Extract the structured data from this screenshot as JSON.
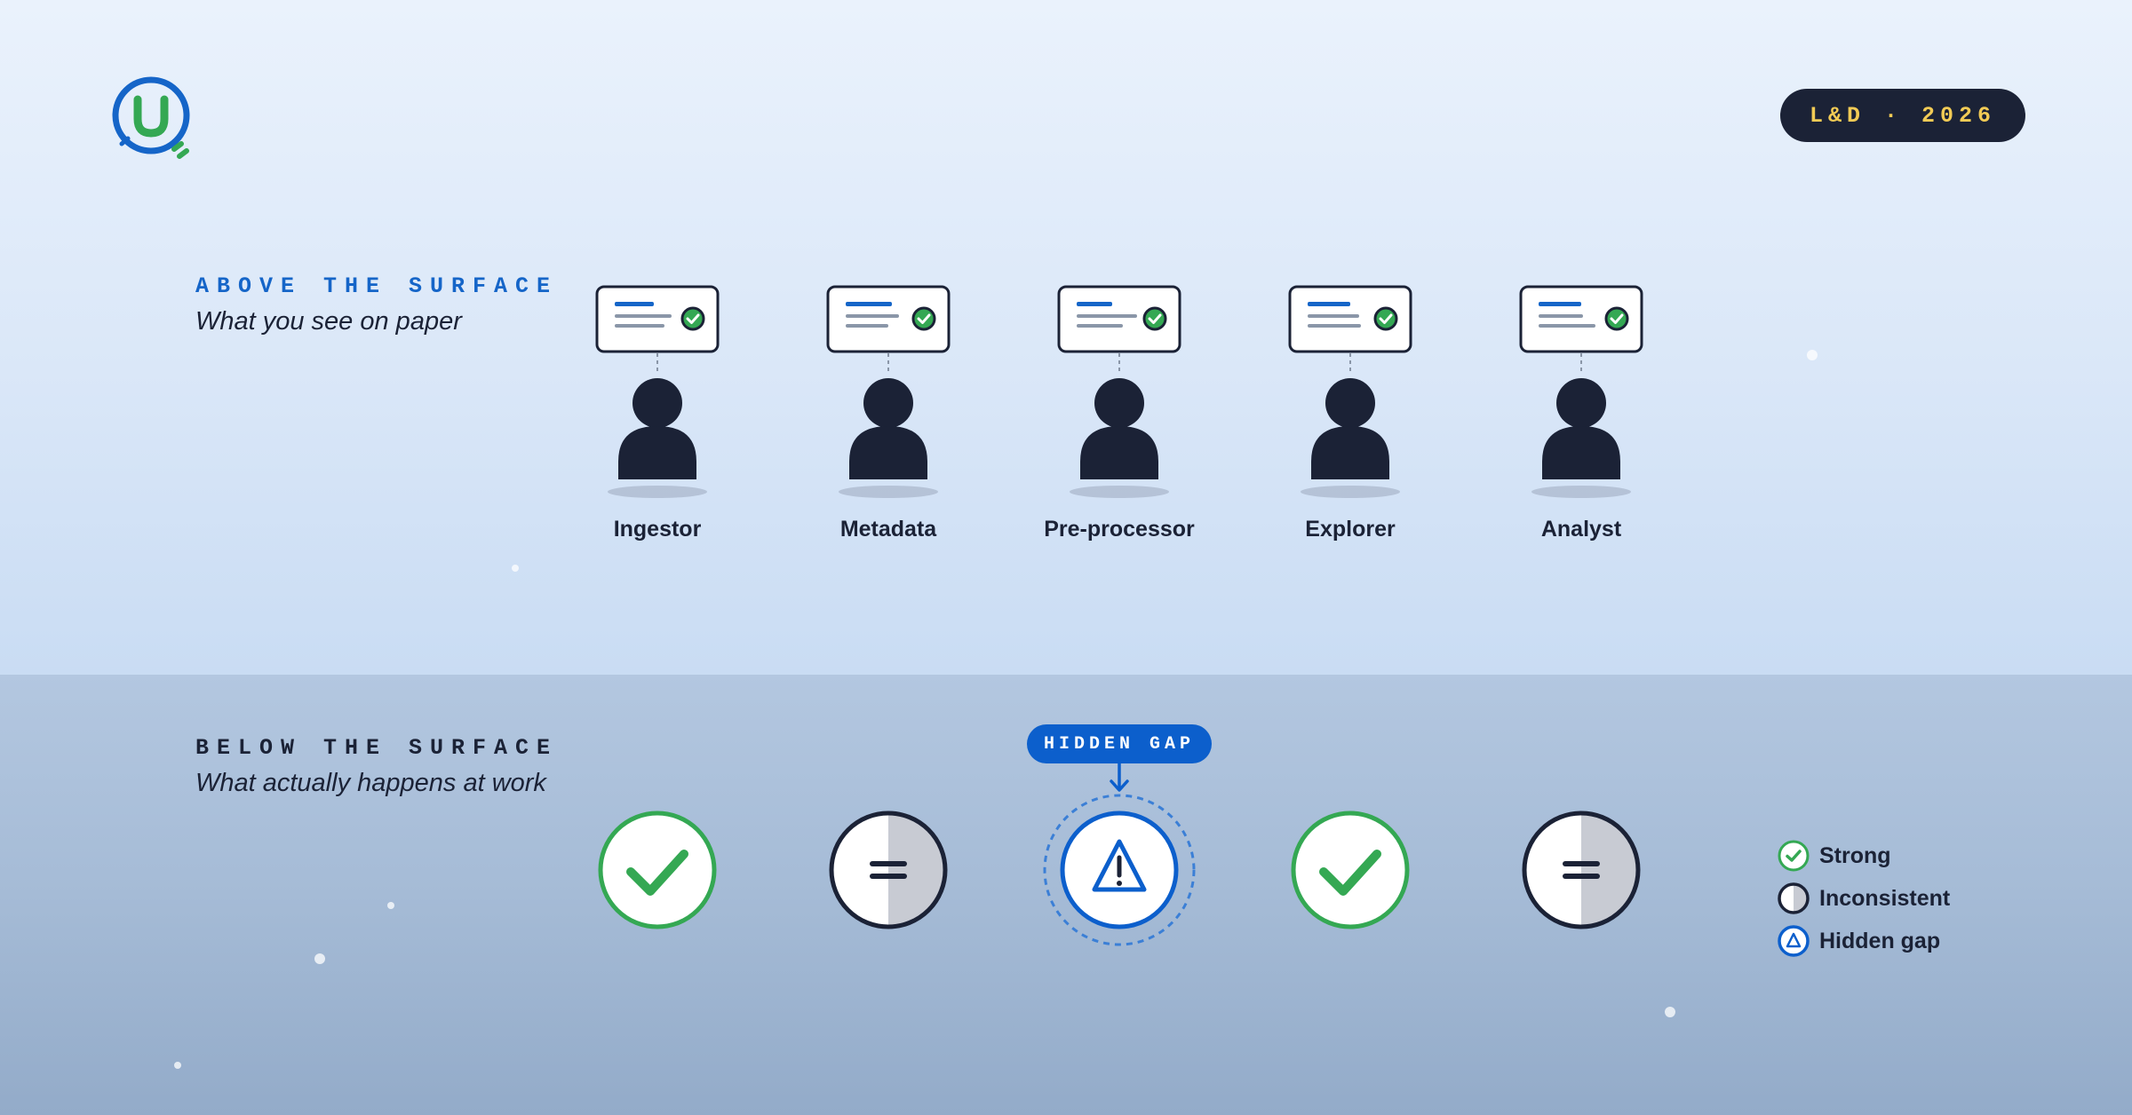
{
  "badge": {
    "text": "L&D · 2026"
  },
  "above": {
    "label": "ABOVE THE SURFACE",
    "subtitle": "What you see on paper"
  },
  "below": {
    "label": "BELOW THE SURFACE",
    "subtitle": "What actually happens at work"
  },
  "roles": [
    {
      "name": "Ingestor",
      "status": "strong"
    },
    {
      "name": "Metadata",
      "status": "inconsistent"
    },
    {
      "name": "Pre-processor",
      "status": "hidden-gap"
    },
    {
      "name": "Explorer",
      "status": "strong"
    },
    {
      "name": "Analyst",
      "status": "inconsistent"
    }
  ],
  "callout": {
    "text": "HIDDEN GAP"
  },
  "legend": [
    {
      "label": "Strong",
      "icon": "check-icon"
    },
    {
      "label": "Inconsistent",
      "icon": "half-circle-icon"
    },
    {
      "label": "Hidden gap",
      "icon": "warning-icon"
    }
  ],
  "colors": {
    "navy": "#1b2236",
    "blue": "#1565c8",
    "green": "#34a853",
    "gold": "#f2cb55"
  }
}
